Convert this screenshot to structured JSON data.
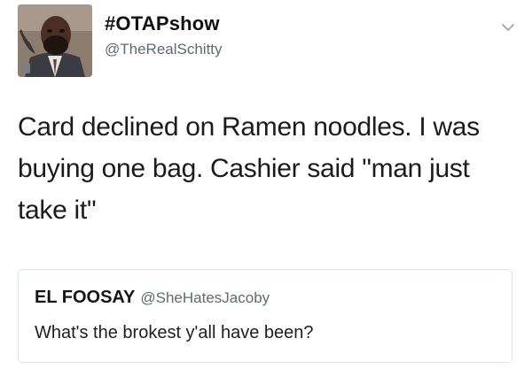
{
  "tweet": {
    "display_name": "#OTAPshow",
    "handle": "@TheRealSchitty",
    "text": "Card declined on Ramen noodles. I was buying one bag. Cashier said \"man just take it\"",
    "avatar_icon": "user-avatar",
    "menu_icon": "chevron-down-icon"
  },
  "quoted_tweet": {
    "name": "EL FOOSAY",
    "handle": "@SheHatesJacoby",
    "text": "What's the brokest y'all have been?"
  }
}
